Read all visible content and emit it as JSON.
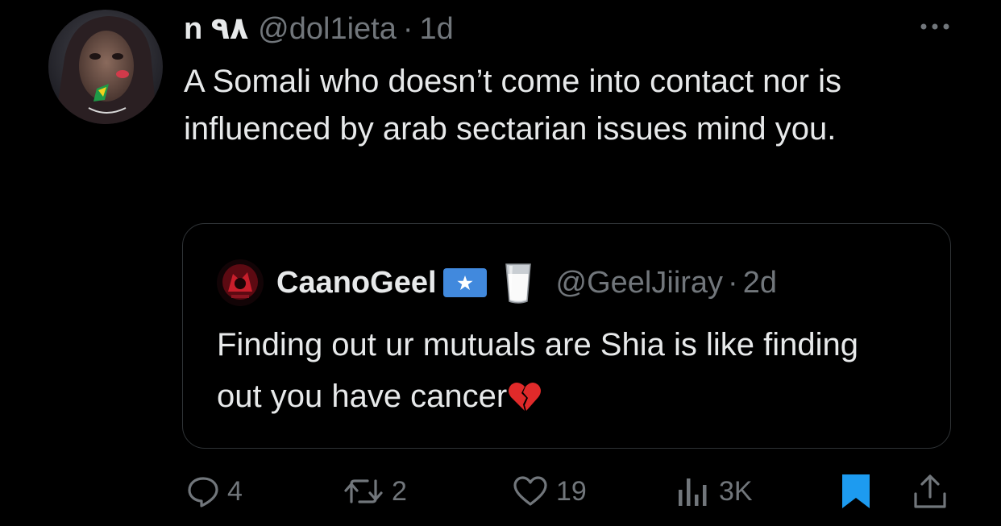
{
  "tweet": {
    "display_name": "n ٩٨",
    "handle": "@dol1ieta",
    "separator": "·",
    "time": "1d",
    "text": "A Somali who doesn’t come into contact nor is influenced by arab sectarian issues mind you."
  },
  "quote": {
    "display_name": "CaanoGeel",
    "handle": "@GeelJiiray",
    "separator": "·",
    "time": "2d",
    "text": "Finding out ur mutuals are Shia is like finding out you have cancer"
  },
  "actions": {
    "replies": "4",
    "retweets": "2",
    "likes": "19",
    "views": "3K"
  },
  "icons": {
    "more": "more-dots-icon",
    "flag": "somalia-flag-icon",
    "milk": "milk-glass-icon",
    "emoji": "broken-heart-icon",
    "reply": "reply-icon",
    "retweet": "retweet-icon",
    "like": "heart-icon",
    "views": "views-icon",
    "bookmark": "bookmark-icon",
    "share": "share-icon"
  },
  "colors": {
    "background": "#000000",
    "text": "#e7e9ea",
    "muted": "#71767b",
    "border": "#2f3336",
    "bookmark_active": "#1d9bf0",
    "flag_blue": "#4189dd"
  }
}
